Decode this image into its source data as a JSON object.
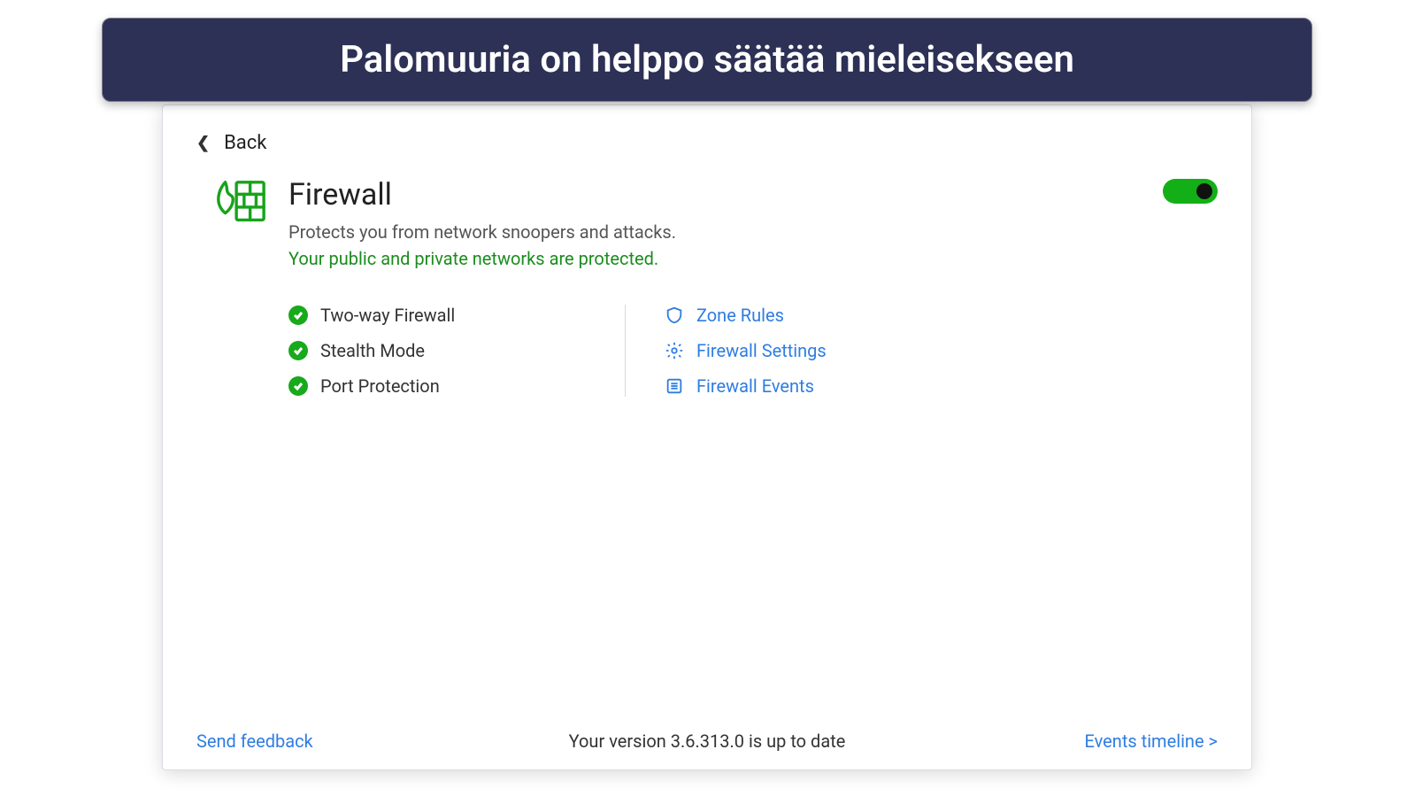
{
  "banner": {
    "title": "Palomuuria on helppo säätää mieleisekseen"
  },
  "nav": {
    "back_label": "Back"
  },
  "header": {
    "title": "Firewall",
    "description": "Protects you from network snoopers and attacks.",
    "status": "Your public and private networks are protected.",
    "toggle_on": true
  },
  "features": [
    {
      "label": "Two-way Firewall"
    },
    {
      "label": "Stealth Mode"
    },
    {
      "label": "Port Protection"
    }
  ],
  "links": [
    {
      "label": "Zone Rules",
      "icon": "shield"
    },
    {
      "label": "Firewall Settings",
      "icon": "gear"
    },
    {
      "label": "Firewall Events",
      "icon": "list"
    }
  ],
  "footer": {
    "feedback": "Send feedback",
    "version": "Your version 3.6.313.0 is up to date",
    "events": "Events timeline >"
  }
}
